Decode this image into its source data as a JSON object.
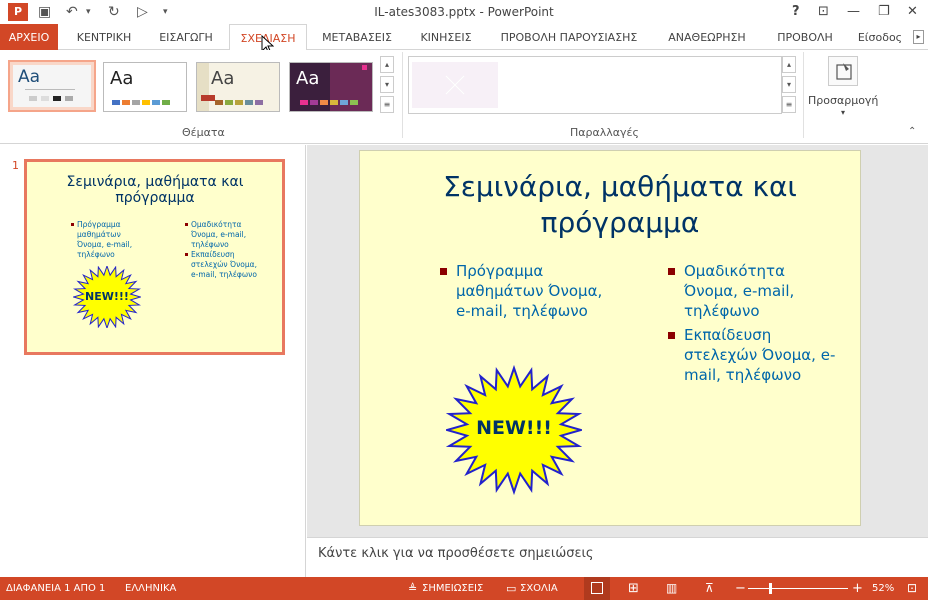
{
  "window": {
    "title": "IL-ates3083.pptx - PowerPoint",
    "help": "?",
    "minimize": "—",
    "restore": "❐",
    "close": "✕"
  },
  "qat": {
    "save": "💾",
    "undo": "↶",
    "redo": "↻",
    "start": "▷",
    "more": "⌄"
  },
  "tabs": [
    {
      "label": "ΑΡΧΕΙΟ"
    },
    {
      "label": "ΚΕΝΤΡΙΚΗ"
    },
    {
      "label": "ΕΙΣΑΓΩΓΗ"
    },
    {
      "label": "ΣΧΕΔΙΑΣΗ"
    },
    {
      "label": "ΜΕΤΑΒΑΣΕΙΣ"
    },
    {
      "label": "ΚΙΝΗΣΕΙΣ"
    },
    {
      "label": "ΠΡΟΒΟΛΗ ΠΑΡΟΥΣΙΑΣΗΣ"
    },
    {
      "label": "ΑΝΑΘΕΩΡΗΣΗ"
    },
    {
      "label": "ΠΡΟΒΟΛΗ"
    },
    {
      "label": "Είσοδος"
    }
  ],
  "ribbon": {
    "themes_label": "Θέματα",
    "variants_label": "Παραλλαγές",
    "customize_label": "Προσαρμογή",
    "theme_aa": "Aa"
  },
  "slide": {
    "number": "1",
    "title": "Σεμινάρια, μαθήματα και πρόγραμμα",
    "left_bullets": [
      "Πρόγραμμα μαθημάτων Όνομα, e-mail, τηλέφωνο"
    ],
    "right_bullets": [
      "Ομαδικότητα Όνομα, e-mail, τηλέφωνο",
      "Εκπαίδευση στελεχών Όνομα, e-mail, τηλέφωνο"
    ],
    "starburst_text": "NEW!!!"
  },
  "notes": {
    "placeholder": "Κάντε κλικ για να προσθέσετε σημειώσεις"
  },
  "status": {
    "slide_info": "ΔΙΑΦΑΝΕΙΑ 1 ΑΠΟ 1",
    "language": "ΕΛΛΗΝΙΚΑ",
    "notes_btn": "ΣΗΜΕΙΩΣΕΙΣ",
    "comments_btn": "ΣΧΟΛΙΑ",
    "zoom": "52%"
  },
  "colors": {
    "accent": "#d24726",
    "slide_bg": "#ffffcc",
    "title": "#003366",
    "bullet_text": "#0066aa",
    "starburst": "#ffff00"
  }
}
